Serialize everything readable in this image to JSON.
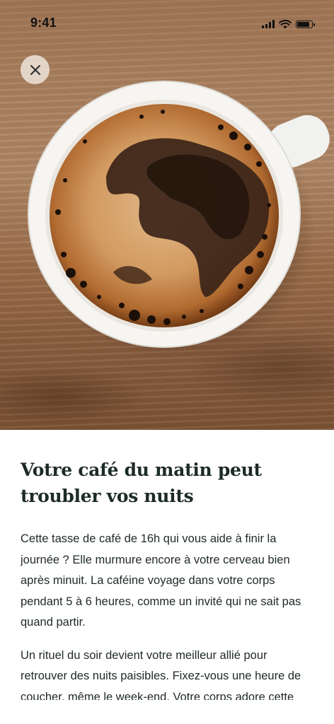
{
  "status_bar": {
    "time": "9:41",
    "signal_icon": "cellular-signal-icon",
    "wifi_icon": "wifi-icon",
    "battery_icon": "battery-icon",
    "battery_level": 0.9
  },
  "hero": {
    "image": "coffee-cup-photo",
    "close_icon": "close-icon"
  },
  "article": {
    "title_line1": "Votre café du matin peut",
    "title_line2": "troubler vos nuits",
    "paragraph1": "Cette tasse de café de 16h qui vous aide à finir la journée ? Elle murmure encore à votre cerveau bien après minuit. La caféine voyage dans votre corps pendant 5 à 6 heures, comme un invité qui ne sait pas quand partir.",
    "paragraph2": "Un rituel du soir devient votre meilleur allié pour retrouver des nuits paisibles. Fixez-vous une heure de coucher, même le week-end. Votre corps adore cette"
  },
  "colors": {
    "title": "#1d2b28",
    "body_text": "#1f2a28",
    "background": "#ffffff"
  }
}
